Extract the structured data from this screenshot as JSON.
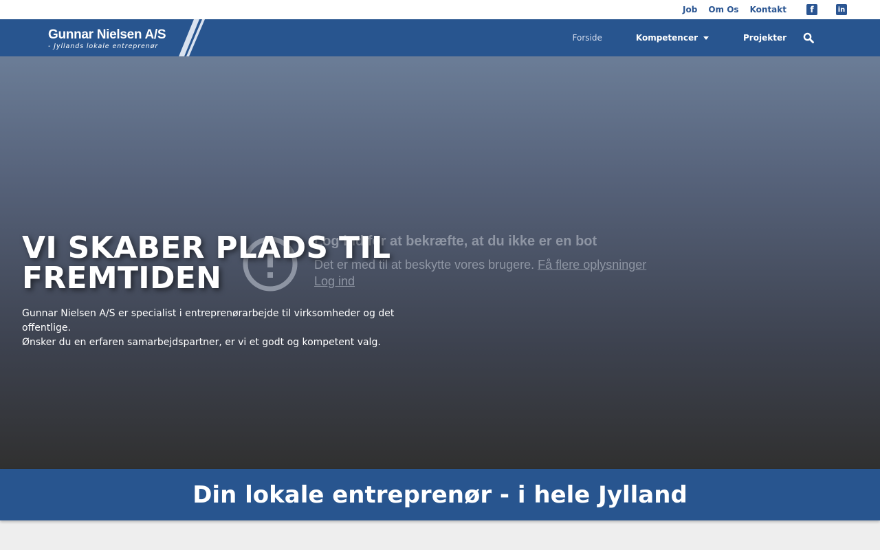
{
  "topbar": {
    "links": [
      "Job",
      "Om Os",
      "Kontakt"
    ],
    "social": [
      {
        "icon": "facebook-icon",
        "glyph": "f"
      },
      {
        "icon": "linkedin-icon",
        "glyph": "in"
      }
    ]
  },
  "header": {
    "logo_name": "Gunnar Nielsen A/S",
    "logo_tagline": "- Jyllands lokale entreprenør",
    "nav": {
      "forside": "Forside",
      "kompetencer": "Kompetencer",
      "projekter": "Projekter"
    }
  },
  "captcha": {
    "title": "Log ind for at bekræfte, at du ikke er en bot",
    "desc": "Det er med til at beskytte vores brugere.",
    "more_link": "Få flere oplysninger",
    "login_link": "Log ind"
  },
  "hero": {
    "title": "VI SKABER PLADS TIL FREMTIDEN",
    "text_line1": "Gunnar Nielsen A/S er specialist i entreprenørarbejde til virksomheder og det offentlige.",
    "text_line2": "Ønsker du en erfaren samarbejdspartner, er vi et godt og kompetent valg."
  },
  "banner": {
    "text": "Din lokale entreprenør - i hele Jylland"
  },
  "colors": {
    "brand_blue": "#28558f",
    "link_blue": "#2a5592",
    "page_bg": "#eeeeee"
  }
}
